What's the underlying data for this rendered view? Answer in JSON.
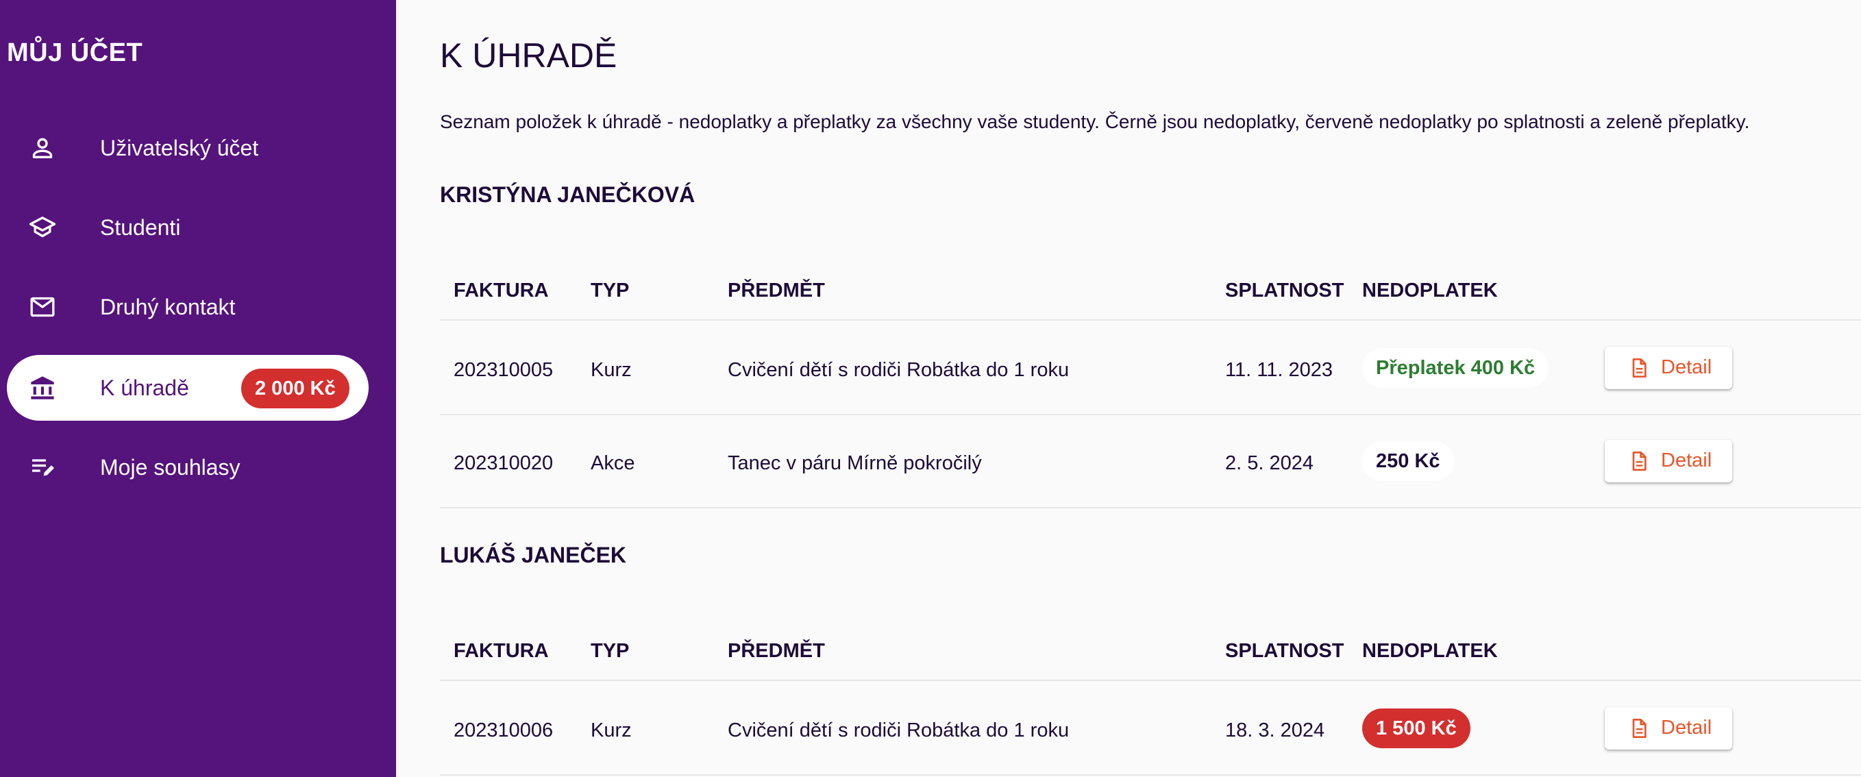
{
  "sidebar": {
    "title": "MŮJ ÚČET",
    "items": [
      {
        "label": "Uživatelský účet",
        "icon": "user-icon"
      },
      {
        "label": "Studenti",
        "icon": "graduation-cap-icon"
      },
      {
        "label": "Druhý kontakt",
        "icon": "envelope-icon"
      },
      {
        "label": "K úhradě",
        "icon": "bank-icon",
        "active": true,
        "badge": "2 000 Kč"
      },
      {
        "label": "Moje souhlasy",
        "icon": "edit-list-icon"
      }
    ]
  },
  "main": {
    "title": "K ÚHRADĚ",
    "intro": "Seznam položek k úhradě - nedoplatky a přeplatky za všechny vaše studenty. Černě jsou nedoplatky, červeně nedoplatky po splatnosti a zeleně přeplatky.",
    "columns": {
      "invoice": "FAKTURA",
      "type": "TYP",
      "subject": "PŘEDMĚT",
      "due": "SPLATNOST",
      "amount": "NEDOPLATEK"
    },
    "detail_label": "Detail",
    "students": [
      {
        "name": "KRISTÝNA JANEČKOVÁ",
        "rows": [
          {
            "invoice": "202310005",
            "type": "Kurz",
            "subject": "Cvičení dětí s rodiči Robátka do 1 roku",
            "due": "11. 11. 2023",
            "amount": "Přeplatek 400 Kč",
            "status": "overpayment"
          },
          {
            "invoice": "202310020",
            "type": "Akce",
            "subject": "Tanec v páru Mírně pokročilý",
            "due": "2. 5. 2024",
            "amount": "250 Kč",
            "status": "underpayment"
          }
        ]
      },
      {
        "name": "LUKÁŠ JANEČEK",
        "rows": [
          {
            "invoice": "202310006",
            "type": "Kurz",
            "subject": "Cvičení dětí s rodiči Robátka do 1 roku",
            "due": "18. 3. 2024",
            "amount": "1 500 Kč",
            "status": "overdue"
          }
        ]
      }
    ]
  },
  "colors": {
    "sidebar_bg": "#55137c",
    "overdue": "#d32f2f",
    "overpayment": "#2e7d32",
    "detail_accent": "#e8552a"
  }
}
